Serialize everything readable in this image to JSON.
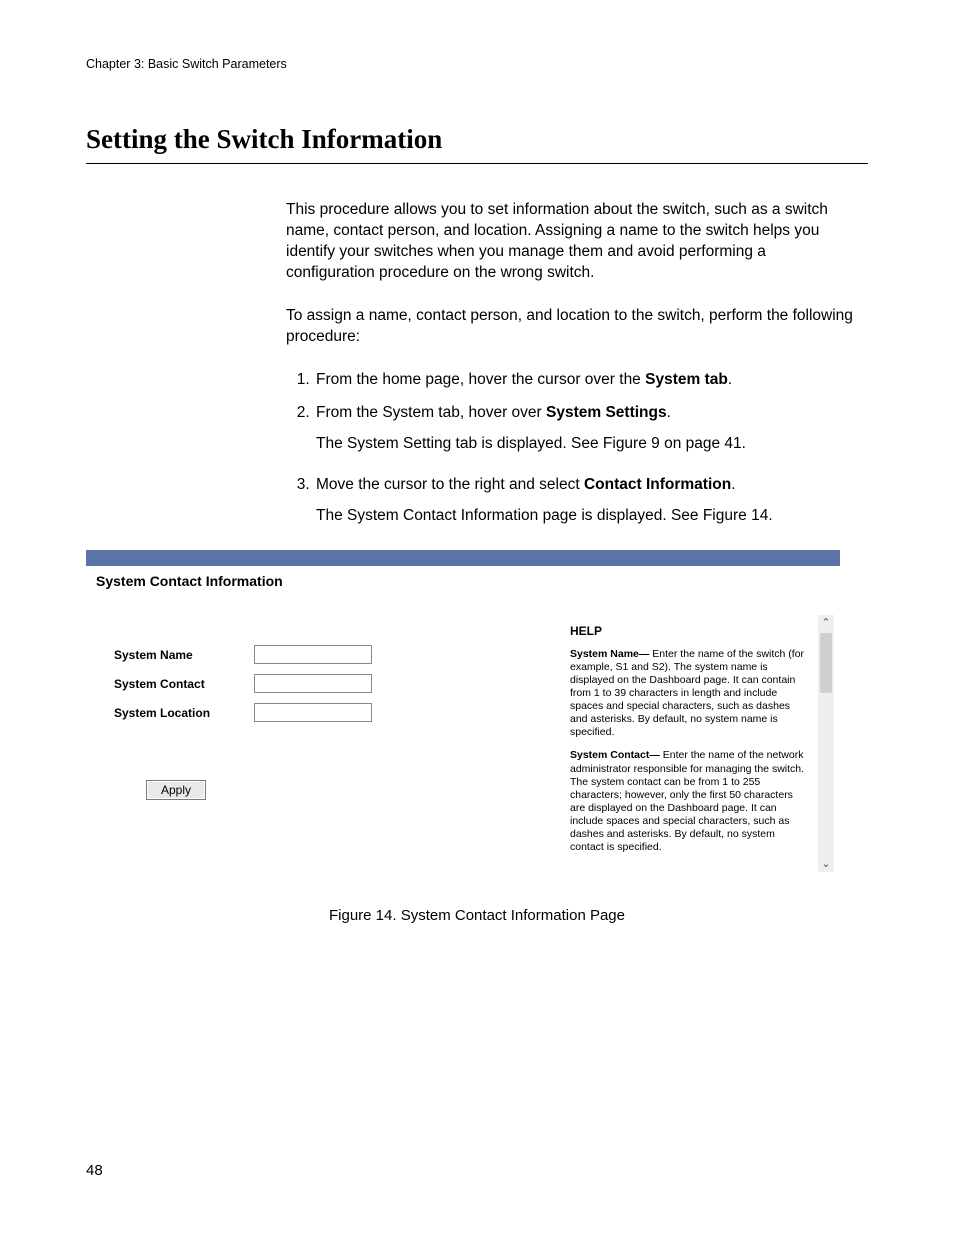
{
  "header": {
    "chapter": "Chapter 3: Basic Switch Parameters"
  },
  "section": {
    "title": "Setting the Switch Information"
  },
  "paras": {
    "intro": "This procedure allows you to set information about the switch, such as a switch name, contact person, and location. Assigning a name to the switch helps you identify your switches when you manage them and avoid performing a configuration procedure on the wrong switch.",
    "lead": "To assign a name, contact person, and location to the switch, perform the following procedure:"
  },
  "steps": {
    "s1_a": "From the home page, hover the cursor over the ",
    "s1_b": "System tab",
    "s1_c": ".",
    "s2_a": "From the System tab, hover over ",
    "s2_b": "System Settings",
    "s2_c": ".",
    "s2_sub": "The System Setting tab is displayed. See Figure 9 on page 41.",
    "s3_a": "Move the cursor to the right and select ",
    "s3_b": "Contact Information",
    "s3_c": ".",
    "s3_sub": "The System Contact Information page is displayed. See Figure 14."
  },
  "figure": {
    "panel_title": "System  Contact  Information",
    "form": {
      "name_label": "System Name",
      "contact_label": "System Contact",
      "location_label": "System Location",
      "apply": "Apply"
    },
    "help": {
      "title": "HELP",
      "p1_b": "System Name—",
      "p1": " Enter the name of the switch (for example, S1 and S2). The system name is displayed on the Dashboard page. It can contain from 1 to 39 characters in length and include spaces and special characters, such as dashes and asterisks. By default, no system name is specified.",
      "p2_b": "System Contact—",
      "p2": " Enter the name of the network administrator responsible for managing the switch. The system contact can be from 1 to 255 characters; however, only the first 50 characters are displayed on the Dashboard page. It can include spaces and special characters, such as dashes and asterisks. By default, no system contact is specified."
    },
    "caption": "Figure 14. System Contact Information Page"
  },
  "page_number": "48"
}
